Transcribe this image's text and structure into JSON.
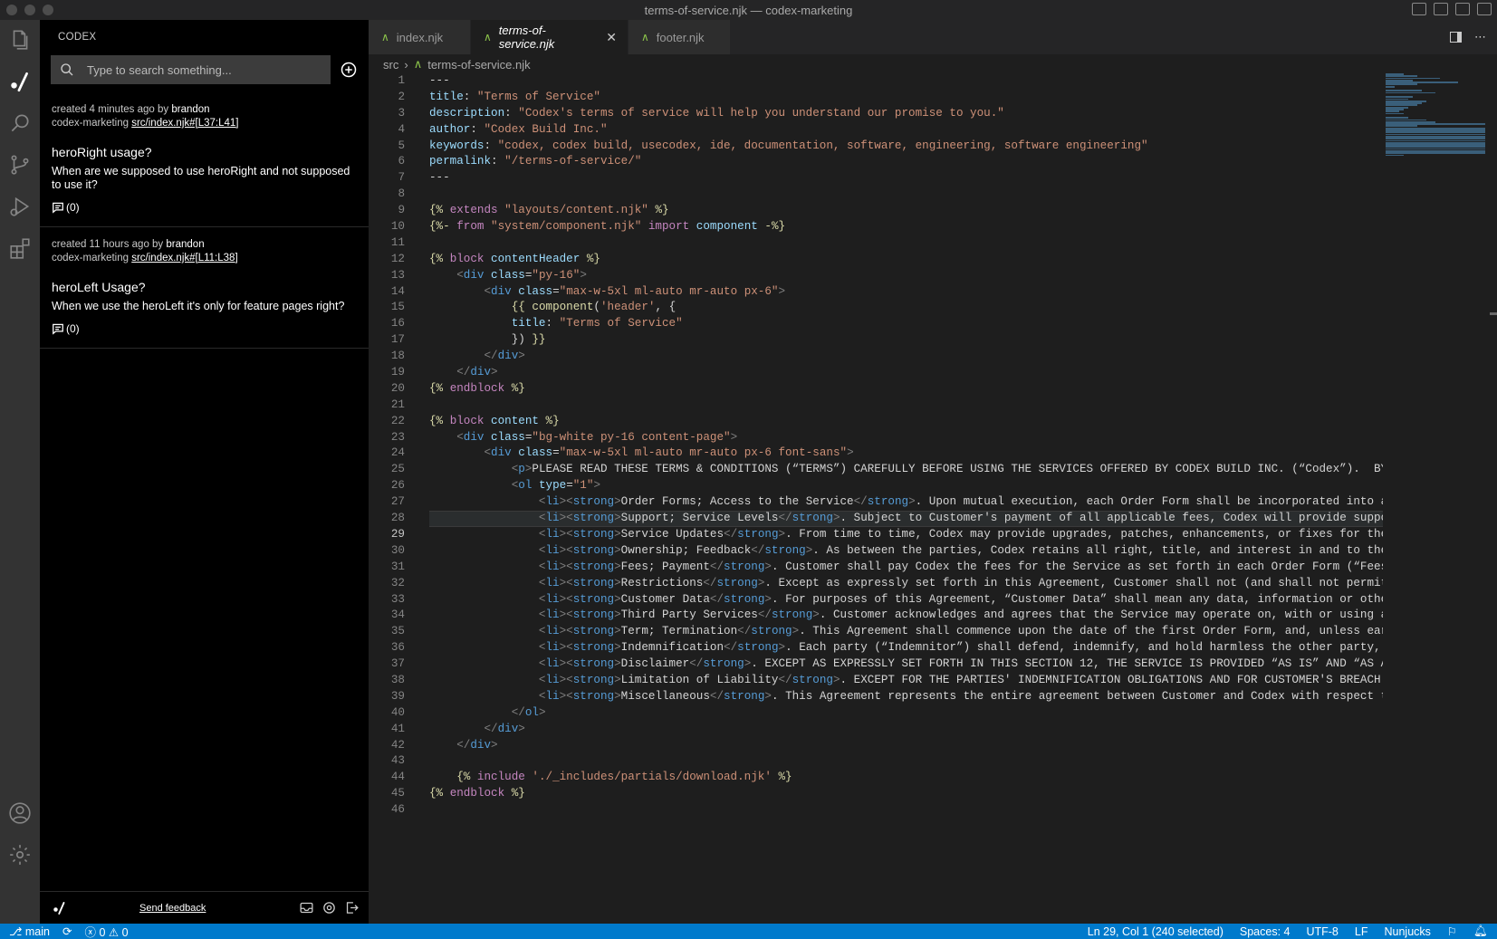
{
  "window": {
    "title": "terms-of-service.njk — codex-marketing"
  },
  "sidebar": {
    "header": "CODEX",
    "search": {
      "placeholder": "Type to search something..."
    },
    "comments": [
      {
        "meta_prefix": "created 4 minutes ago by",
        "author": "brandon",
        "repo": "codex-marketing",
        "link": "src/index.njk#[L37:L41]",
        "title": "heroRight usage?",
        "body": "When are we supposed to use heroRight and not supposed to use it?",
        "count": "(0)"
      },
      {
        "meta_prefix": "created 11 hours ago by",
        "author": "brandon",
        "repo": "codex-marketing",
        "link": "src/index.njk#[L11:L38]",
        "title": "heroLeft Usage?",
        "body": "When we use the heroLeft it's only for feature pages right?",
        "count": "(0)"
      }
    ],
    "footer": {
      "feedback": "Send feedback"
    }
  },
  "tabs": [
    {
      "label": "index.njk",
      "active": false
    },
    {
      "label": "terms-of-service.njk",
      "active": true
    },
    {
      "label": "footer.njk",
      "active": false
    }
  ],
  "breadcrumb": {
    "folder": "src",
    "file": "terms-of-service.njk"
  },
  "editor": {
    "current_line": 29,
    "lines": [
      "1",
      "2",
      "3",
      "4",
      "5",
      "6",
      "7",
      "8",
      "9",
      "10",
      "11",
      "12",
      "13",
      "14",
      "15",
      "16",
      "17",
      "18",
      "19",
      "20",
      "21",
      "22",
      "23",
      "24",
      "25",
      "26",
      "27",
      "28",
      "29",
      "30",
      "31",
      "32",
      "33",
      "34",
      "35",
      "36",
      "37",
      "38",
      "39",
      "40",
      "41",
      "42",
      "43",
      "44",
      "45",
      "46"
    ]
  },
  "statusbar": {
    "branch": "main",
    "errors": "0",
    "warnings": "0",
    "position": "Ln 29, Col 1 (240 selected)",
    "spaces": "Spaces: 4",
    "encoding": "UTF-8",
    "eol": "LF",
    "language": "Nunjucks"
  },
  "icons": {
    "explorer": "files-icon",
    "codex": "codex-icon",
    "search": "search-icon",
    "scm": "source-control-icon",
    "debug": "run-debug-icon",
    "extensions": "extensions-icon",
    "account": "account-icon",
    "manage": "gear-icon"
  }
}
